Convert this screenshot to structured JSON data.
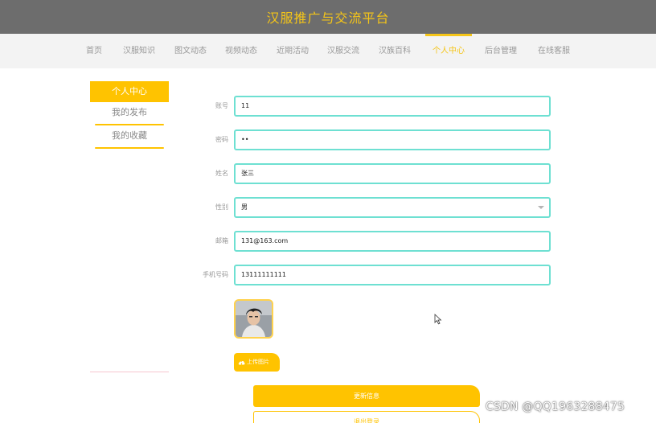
{
  "header": {
    "title": "汉服推广与交流平台"
  },
  "nav": {
    "items": [
      {
        "label": "首页"
      },
      {
        "label": "汉服知识"
      },
      {
        "label": "图文动态"
      },
      {
        "label": "视频动态"
      },
      {
        "label": "近期活动"
      },
      {
        "label": "汉服交流"
      },
      {
        "label": "汉族百科"
      },
      {
        "label": "个人中心",
        "active": true
      },
      {
        "label": "后台管理"
      },
      {
        "label": "在线客服"
      }
    ]
  },
  "sidebar": {
    "header": "个人中心",
    "items": [
      {
        "label": "我的发布"
      },
      {
        "label": "我的收藏"
      }
    ]
  },
  "form": {
    "account": {
      "label": "账号",
      "value": "11"
    },
    "password": {
      "label": "密码",
      "value": "••"
    },
    "name": {
      "label": "姓名",
      "value": "张三"
    },
    "gender": {
      "label": "性别",
      "value": "男"
    },
    "email": {
      "label": "邮箱",
      "value": "131@163.com"
    },
    "phone": {
      "label": "手机号码",
      "value": "13111111111"
    },
    "upload_label": "上传图片",
    "update_label": "更新信息",
    "logout_label": "退出登录"
  },
  "icons": {
    "upload": "cloud-upload-icon",
    "select": "chevron-down-icon",
    "cursor": "mouse-pointer-icon"
  },
  "colors": {
    "accent": "#ffc300",
    "header_bg": "#6d6d6d",
    "field_border": "#6ee0d2"
  },
  "watermark": "CSDN @QQ1963288475"
}
